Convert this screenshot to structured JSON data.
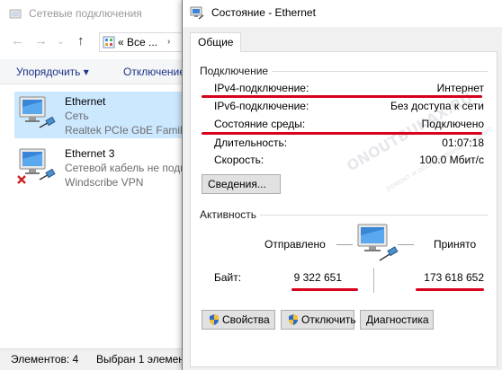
{
  "explorer": {
    "title": "Сетевые подключения",
    "address": "Все ...",
    "address_prefix": "«",
    "toolbar": {
      "organize": "Упорядочить",
      "disable": "Отключение"
    },
    "connections": [
      {
        "name": "Ethernet",
        "status": "Сеть",
        "device": "Realtek PCIe GbE Family"
      },
      {
        "name": "Ethernet 3",
        "status": "Сетевой кабель не подк",
        "device": "Windscribe VPN"
      }
    ],
    "statusbar": {
      "items": "Элементов: 4",
      "selected": "Выбран 1 элемен"
    }
  },
  "dialog": {
    "title": "Состояние - Ethernet",
    "tab": "Общие",
    "connection": {
      "heading": "Подключение",
      "rows": [
        {
          "label": "IPv4-подключение:",
          "value": "Интернет"
        },
        {
          "label": "IPv6-подключение:",
          "value": "Без доступа к сети"
        },
        {
          "label": "Состояние среды:",
          "value": "Подключено"
        },
        {
          "label": "Длительность:",
          "value": "01:07:18"
        },
        {
          "label": "Скорость:",
          "value": "100.0 Мбит/с"
        }
      ],
      "details_button": "Сведения..."
    },
    "activity": {
      "heading": "Активность",
      "sent_label": "Отправлено",
      "received_label": "Принято",
      "bytes_label": "Байт:",
      "sent_bytes": "9 322 651",
      "received_bytes": "173 618 652"
    },
    "buttons": {
      "properties": "Свойства",
      "disable": "Отключить",
      "diagnose": "Диагностика"
    }
  },
  "watermark": {
    "main": "ONOUTBUKAX.RU",
    "sub": "ремонт и обслуживание, ремонт"
  },
  "colors": {
    "accent_red": "#d7001d",
    "selection": "#cce8ff",
    "link_blue": "#1e3287"
  },
  "icons": {
    "network": "network-adapter-icon",
    "shield": "uac-shield-icon",
    "disconnected": "red-x-icon"
  }
}
